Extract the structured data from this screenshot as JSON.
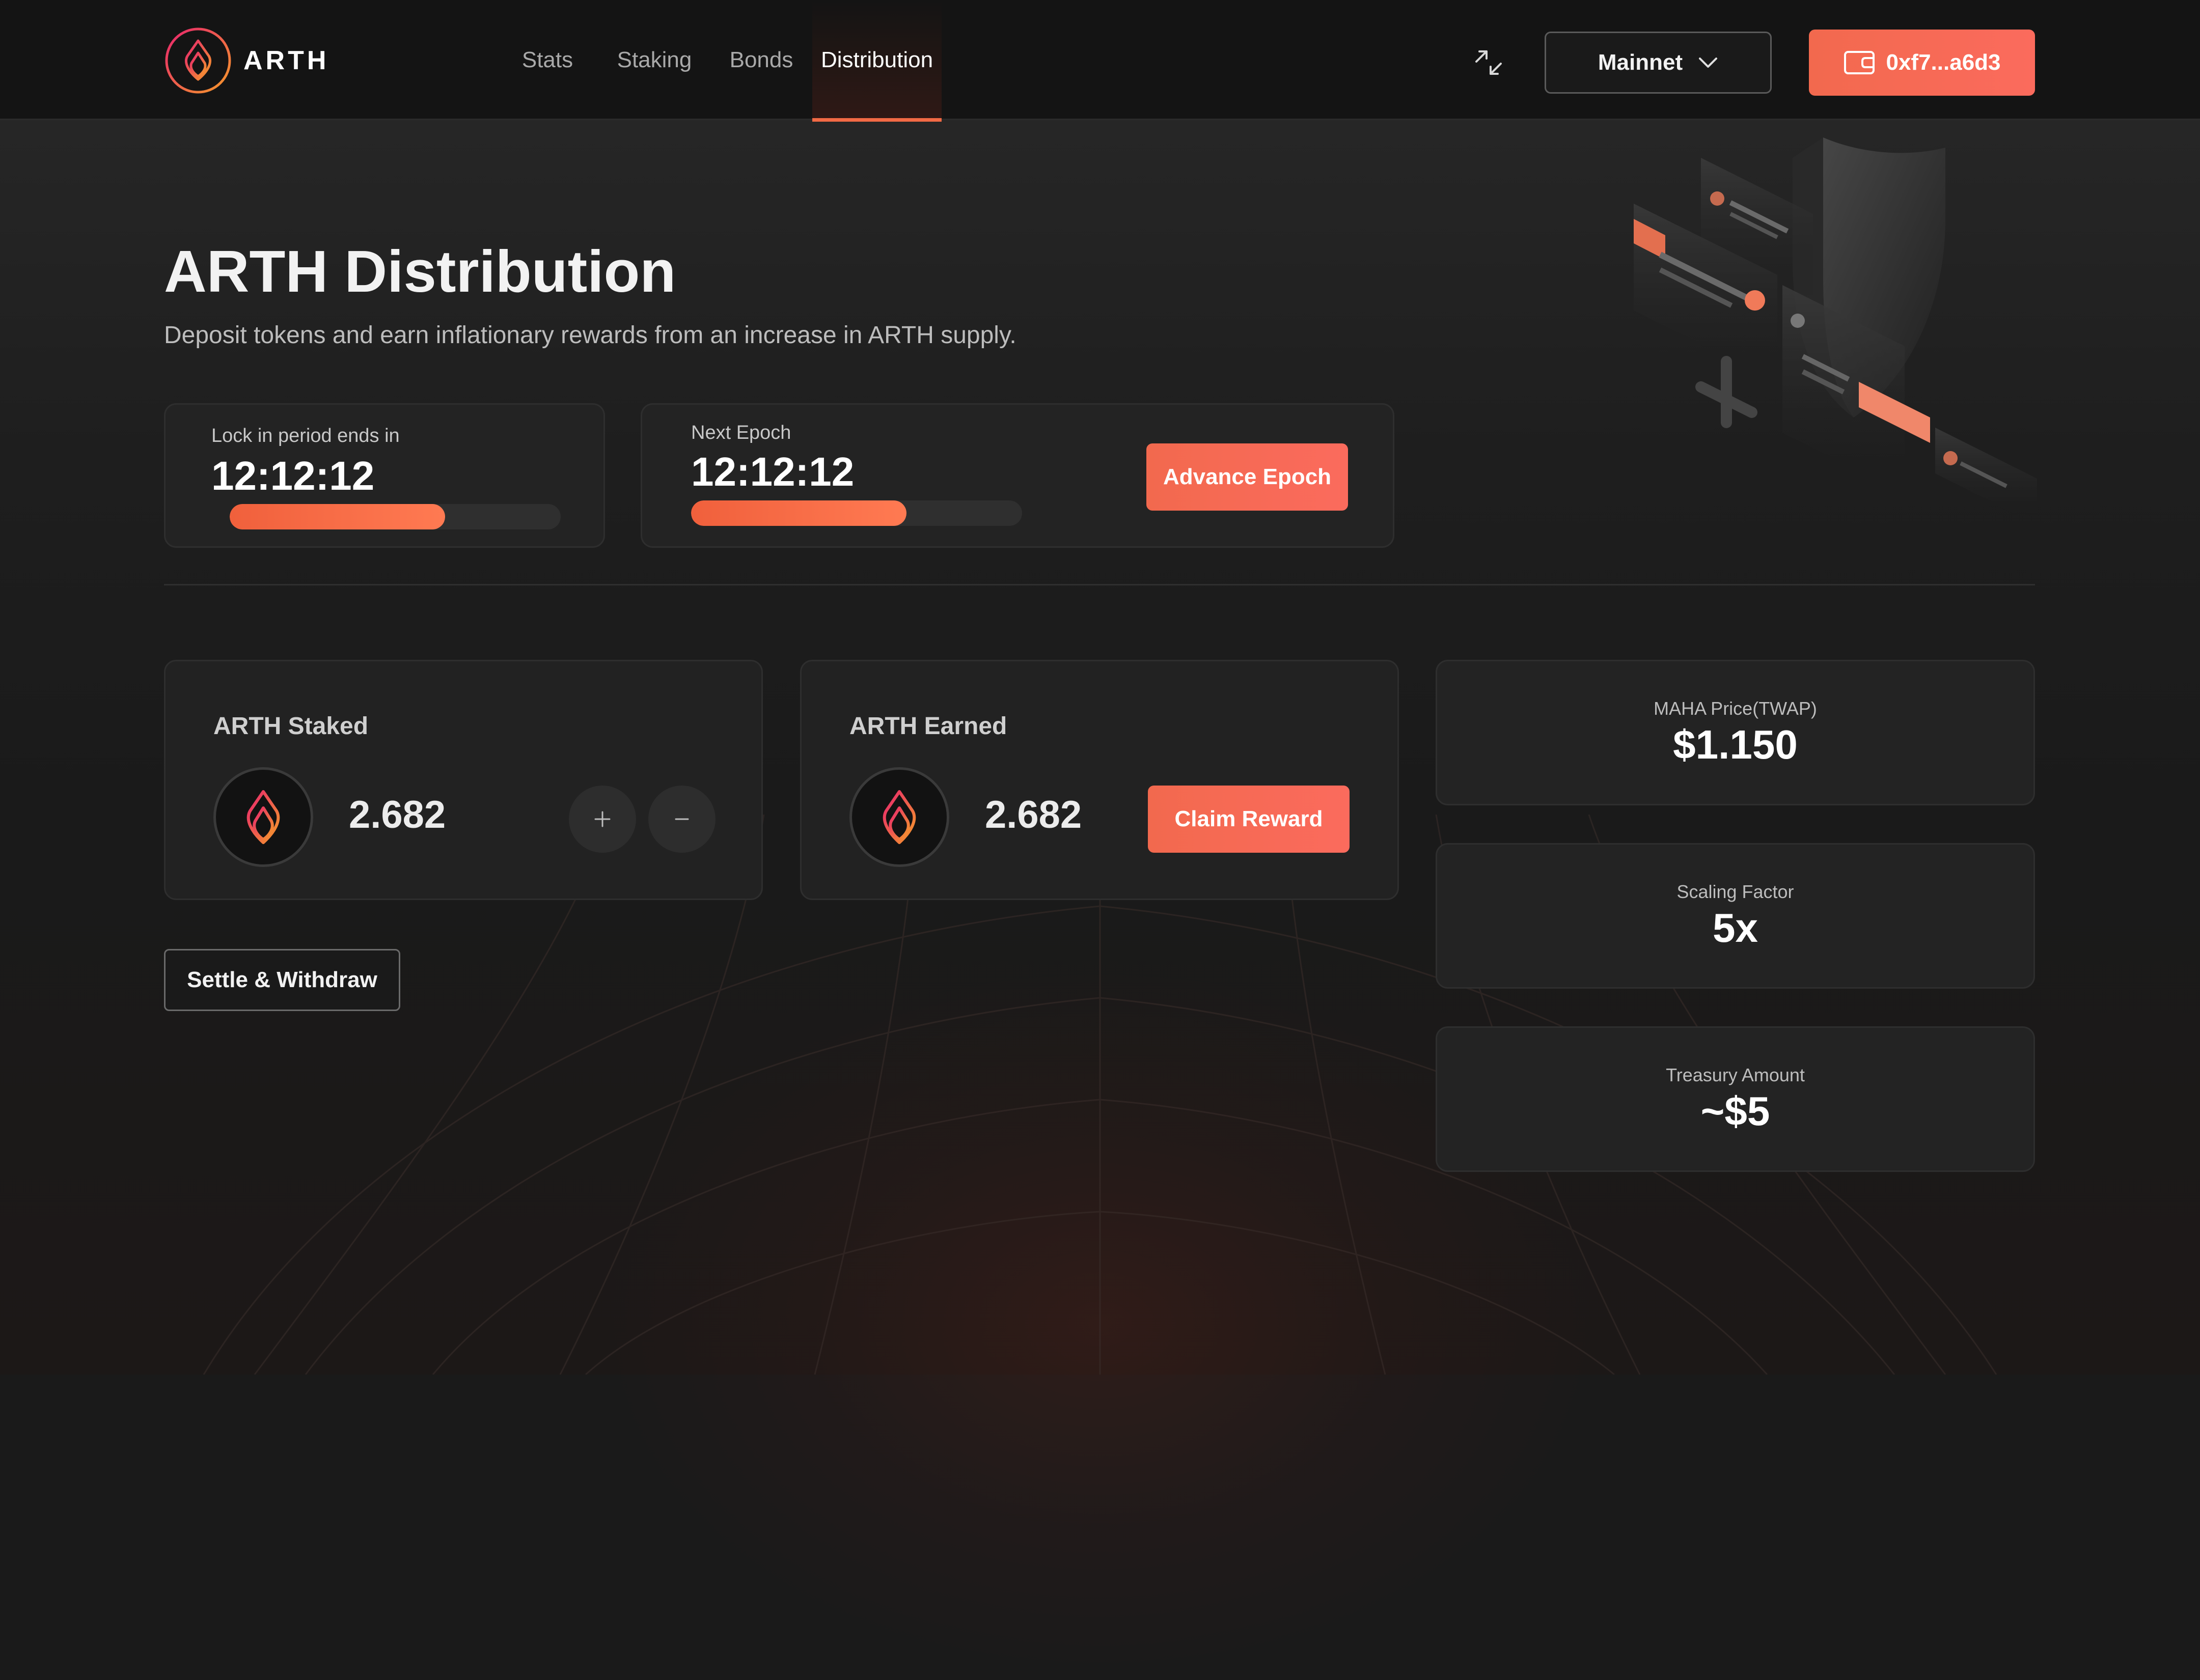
{
  "header": {
    "logo_text": "ARTH",
    "nav": [
      {
        "label": "Stats",
        "active": false
      },
      {
        "label": "Staking",
        "active": false
      },
      {
        "label": "Bonds",
        "active": false
      },
      {
        "label": "Distribution",
        "active": true
      }
    ],
    "expand_icon": "expand-arrows-icon",
    "network": {
      "selected": "Mainnet",
      "icon": "chevron-down-icon"
    },
    "wallet": {
      "label": "0xf7...a6d3",
      "icon": "wallet-icon"
    }
  },
  "hero": {
    "title": "ARTH Distribution",
    "subtitle": "Deposit tokens and earn inflationary rewards from an increase in ARTH supply."
  },
  "lock_timer": {
    "caption": "Lock in period ends in",
    "value": "12:12:12",
    "progress": 0.65
  },
  "epoch_timer": {
    "caption": "Next Epoch",
    "value": "12:12:12",
    "progress": 0.65,
    "button_label": "Advance Epoch"
  },
  "staked_card": {
    "title": "ARTH Staked",
    "amount": "2.682",
    "token_icon": "arth-token-icon",
    "plus_icon": "plus-icon",
    "minus_icon": "minus-icon"
  },
  "earned_card": {
    "title": "ARTH Earned",
    "amount": "2.682",
    "token_icon": "arth-token-icon",
    "button_label": "Claim Reward"
  },
  "settle_button": "Settle & Withdraw",
  "stats": {
    "maha_price": {
      "label": "MAHA Price(TWAP)",
      "value": "$1.150"
    },
    "scaling_factor": {
      "label": "Scaling Factor",
      "value": "5x"
    },
    "treasury": {
      "label": "Treasury Amount",
      "value": "~$5"
    }
  },
  "colors": {
    "accent": "#f26a45",
    "button_gradient_start": "#f2694e",
    "button_gradient_end": "#fb6b5d",
    "background": "#1a1a1a",
    "card": "#232323"
  }
}
